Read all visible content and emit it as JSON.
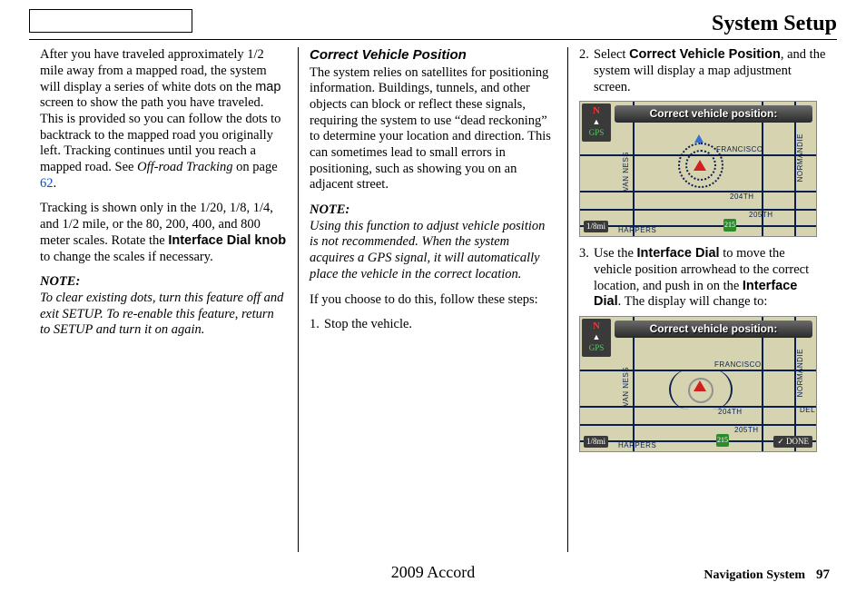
{
  "header": {
    "title": "System Setup"
  },
  "col1": {
    "p1a": "After you have traveled approximately 1/2 mile away from a mapped road, the system will display a series of white dots on the ",
    "p1_map": "map",
    "p1b": " screen to show the path you have traveled. This is provided so you can follow the dots to backtrack to the mapped road you originally left. Tracking continues until you reach a mapped road. See ",
    "p1_off": "Off-road Tracking",
    "p1_on": " on page ",
    "p1_link": "62",
    "p1_end": ".",
    "p2a": "Tracking is shown only in the 1/20, 1/8, 1/4, and 1/2 mile, or the 80, 200, 400, and 800 meter scales. Rotate the ",
    "p2_knob": "Interface Dial knob",
    "p2b": " to change the scales if necessary.",
    "note_label": "NOTE:",
    "note_body": "To clear existing dots, turn this feature off and exit SETUP. To re-enable this feature, return to SETUP and turn it on again."
  },
  "col2": {
    "heading": "Correct Vehicle Position",
    "p1": "The system relies on satellites for positioning information. Buildings, tunnels, and other objects can block or reflect these signals, requiring the system to use “dead reckoning” to determine your location and direction. This can sometimes lead to small errors in positioning, such as showing you on an adjacent street.",
    "note_label": "NOTE:",
    "note_body": "Using this function to adjust vehicle position is not recommended. When the system acquires a GPS signal, it will automatically place the vehicle in the correct location.",
    "p2": "If you choose to do this, follow these steps:",
    "step1_num": "1.",
    "step1_body": "Stop the vehicle."
  },
  "col3": {
    "step2_num": "2.",
    "step2a": "Select ",
    "step2_bold": "Correct Vehicle Position",
    "step2b": ", and the system will display a map adjustment screen.",
    "step3_num": "3.",
    "step3a": "Use the ",
    "step3_bold1": "Interface Dial",
    "step3b": " to move the vehicle position arrowhead to the correct location, and push in on the ",
    "step3_bold2": "Interface Dial",
    "step3c": ". The display will change to:"
  },
  "screenshot": {
    "header": "Correct vehicle position:",
    "compass_n": "N",
    "gps": "GPS",
    "scale": "1/8mi",
    "shield": "215",
    "done": "DONE",
    "streets": {
      "van_ness": "VAN NESS",
      "normandie": "NORMANDIE",
      "francisco": "FRANCISCO",
      "204th": "204TH",
      "205th": "205TH",
      "harpers": "HARPERS",
      "del": "DEL"
    }
  },
  "footer": {
    "center": "2009  Accord",
    "navsys": "Navigation System",
    "page": "97"
  }
}
